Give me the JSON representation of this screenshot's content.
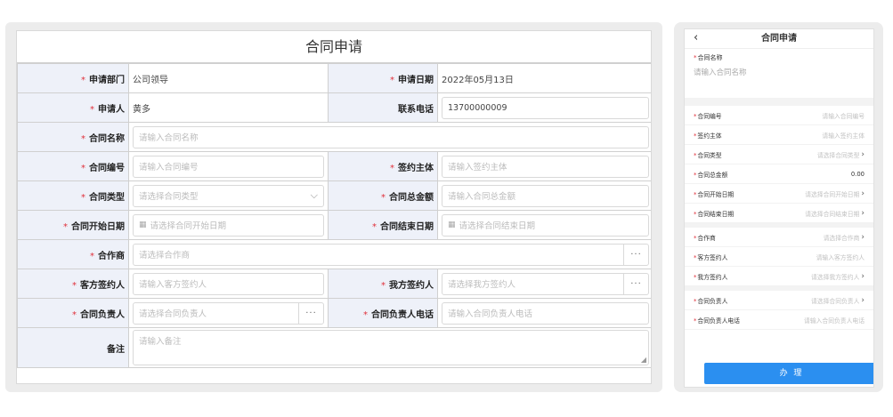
{
  "desktop": {
    "title": "合同申请",
    "fields": {
      "dept_label": "申请部门",
      "dept_value": "公司领导",
      "date_label": "申请日期",
      "date_value": "2022年05月13日",
      "applicant_label": "申请人",
      "applicant_value": "黄多",
      "phone_label": "联系电话",
      "phone_value": "13700000009",
      "name_label": "合同名称",
      "name_placeholder": "请输入合同名称",
      "number_label": "合同编号",
      "number_placeholder": "请输入合同编号",
      "subject_label": "签约主体",
      "subject_placeholder": "请输入签约主体",
      "type_label": "合同类型",
      "type_placeholder": "请选择合同类型",
      "amount_label": "合同总金额",
      "amount_placeholder": "请输入合同总金额",
      "start_label": "合同开始日期",
      "start_placeholder": "请选择合同开始日期",
      "end_label": "合同结束日期",
      "end_placeholder": "请选择合同结束日期",
      "partner_label": "合作商",
      "partner_placeholder": "请选择合作商",
      "client_signer_label": "客方签约人",
      "client_signer_placeholder": "请输入客方签约人",
      "our_signer_label": "我方签约人",
      "our_signer_placeholder": "请选择我方签约人",
      "owner_label": "合同负责人",
      "owner_placeholder": "请选择合同负责人",
      "owner_phone_label": "合同负责人电话",
      "owner_phone_placeholder": "请输入合同负责人电话",
      "remark_label": "备注",
      "remark_placeholder": "请输入备注"
    }
  },
  "mobile": {
    "title": "合同申请",
    "name_label": "合同名称",
    "name_placeholder": "请输入合同名称",
    "rows": {
      "number_label": "合同编号",
      "number_value": "请输入合同编号",
      "subject_label": "签约主体",
      "subject_value": "请输入签约主体",
      "type_label": "合同类型",
      "type_value": "请选择合同类型",
      "amount_label": "合同总金额",
      "amount_value": "0.00",
      "start_label": "合同开始日期",
      "start_value": "请选择合同开始日期",
      "end_label": "合同结束日期",
      "end_value": "请选择合同结束日期",
      "partner_label": "合作商",
      "partner_value": "请选择合作商",
      "client_signer_label": "客方签约人",
      "client_signer_value": "请输入客方签约人",
      "our_signer_label": "我方签约人",
      "our_signer_value": "请选择我方签约人",
      "owner_label": "合同负责人",
      "owner_value": "请选择合同负责人",
      "owner_phone_label": "合同负责人电话",
      "owner_phone_value": "请输入合同负责人电话"
    },
    "submit_label": "办 理"
  },
  "icons": {
    "required_mark": "*",
    "chevron_right": "›",
    "chevron_down": "⌵",
    "back": "‹",
    "more": "···",
    "calendar": "📅"
  },
  "colors": {
    "accent": "#2b8ff0",
    "required": "#e0303a",
    "label_bg": "#eef1f9"
  }
}
